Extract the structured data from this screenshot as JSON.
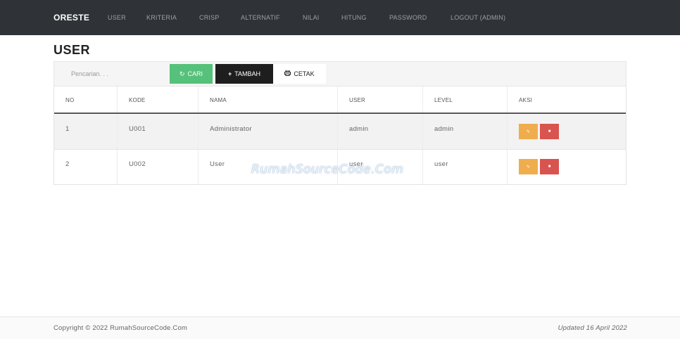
{
  "navbar": {
    "brand": "ORESTE",
    "items": [
      "USER",
      "KRITERIA",
      "CRISP",
      "ALTERNATIF",
      "NILAI",
      "HITUNG",
      "PASSWORD",
      "LOGOUT (ADMIN)"
    ]
  },
  "page": {
    "title": "USER"
  },
  "toolbar": {
    "search_placeholder": "Pencarian. . .",
    "cari_label": "CARI",
    "tambah_label": "TAMBAH",
    "cetak_label": "CETAK"
  },
  "icons": {
    "cari": "refresh-icon",
    "tambah": "plus-icon",
    "cetak": "print-icon",
    "edit": "edit-icon",
    "delete": "delete-icon"
  },
  "table": {
    "headers": [
      "NO",
      "KODE",
      "NAMA",
      "USER",
      "LEVEL",
      "AKSI"
    ],
    "rows": [
      {
        "no": "1",
        "kode": "U001",
        "nama": "Administrator",
        "user": "admin",
        "level": "admin"
      },
      {
        "no": "2",
        "kode": "U002",
        "nama": "User",
        "user": "user",
        "level": "user"
      }
    ]
  },
  "watermark": "RumahSourceCode.Com",
  "footer": {
    "copyright": "Copyright © 2022 RumahSourceCode.Com",
    "updated": "Updated 16 April 2022"
  },
  "colors": {
    "navbar": "#2f3337",
    "cari": "#56c17a",
    "tambah": "#1e1e1e",
    "edit": "#f0ad4e",
    "delete": "#d9534f"
  }
}
